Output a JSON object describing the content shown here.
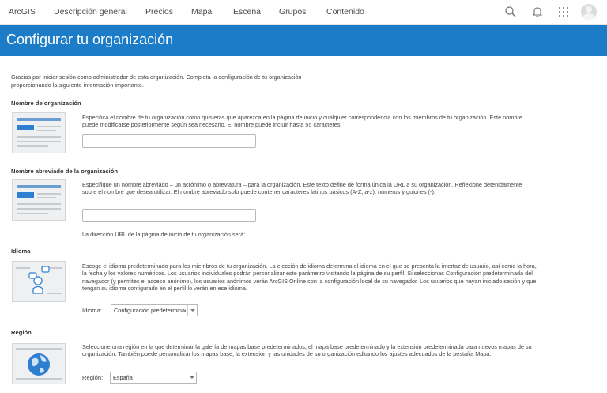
{
  "nav": {
    "brand": "ArcGIS",
    "items": [
      "Descripción general",
      "Precios",
      "Mapa",
      "Escena",
      "Grupos",
      "Contenido"
    ],
    "icons": [
      "search-icon",
      "bell-icon",
      "apps-grid-icon",
      "user-avatar"
    ]
  },
  "banner": {
    "title": "Configurar tu organización",
    "color": "#1c7cc7"
  },
  "intro": "Gracias por iniciar sesión como administrador de esta organización. Completa la configuración de tu organización proporcionando la siguiente información importante.",
  "sections": {
    "org_name": {
      "title": "Nombre de organización",
      "description": "Especifica el nombre de tu organización como quisieras que aparezca en la página de inicio y cualquier correspondencia con los miembros de tu organización. Este nombre puede modificarse posteriormente según sea necesario. El nombre puede incluir hasta 55 caracteres.",
      "value": ""
    },
    "short_name": {
      "title": "Nombre abreviado de la organización",
      "description": "Especifique un nombre abreviado – un acrónimo o abreviatura – para la organización. Este texto define de forma única la URL a su organización. Reflexione detenidamente sobre el nombre que desea utilizar. El nombre abreviado solo puede contener caracteres latinos básicos (A-Z, a-z), números y guiones (-).",
      "value": "",
      "url_note": "La dirección URL de la página de inicio de tu organización será:"
    },
    "language": {
      "title": "Idioma",
      "description": "Escoge el idioma predeterminado para los miembros de tu organización. La elección de idioma determina el idioma en el que se presenta la interfaz de usuario, así como la hora, la fecha y los valores numéricos. Los usuarios individuales podrán personalizar este parámetro visitando la página de su perfil. Si seleccionas Configuración predeterminada del navegador (y permites el acceso anónimo), los usuarios anónimos verán ArcGIS Online con la configuración local de su navegador. Los usuarios que hayan iniciado sesión y que tengan su idioma configurado en el perfil lo verán en ese idioma.",
      "label": "Idioma:",
      "selected": "Configuración predeterminada del navegador"
    },
    "region": {
      "title": "Región",
      "description": "Seleccione una región en la que determinar la galería de mapas base predeterminados, el mapa base predeterminado y la extensión predeterminada para nuevos mapas de su organización. También puede personalizar los mapas base, la extensión y las unidades de su organización editando los ajustes adecuados de la pestaña Mapa.",
      "label": "Región:",
      "selected": "España"
    }
  }
}
